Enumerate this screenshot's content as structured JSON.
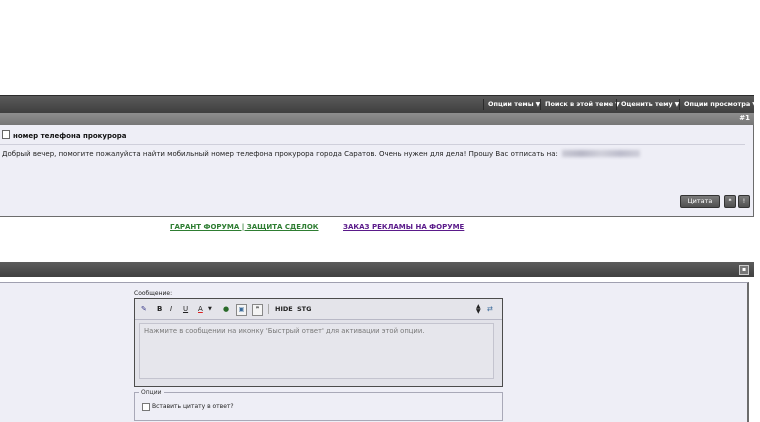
{
  "thread_tools": [
    {
      "label": "Опции темы"
    },
    {
      "label": "Поиск в этой теме"
    },
    {
      "label": "Оценить тему"
    },
    {
      "label": "Опции просмотра"
    }
  ],
  "post": {
    "number": "#1",
    "title": "номер телефона прокурора",
    "text": "Добрый вечер, помогите пожалуйста найти мобильный номер телефона прокурора города Саратов. Очень нужен для дела! Прошу Вас отписать на:",
    "quote_button": "Цитата"
  },
  "ads": {
    "guarantee": "ГАРАНТ ФОРУМА | ЗАЩИТА СДЕЛОК",
    "advertising": "ЗАКАЗ РЕКЛАМЫ НА ФОРУМЕ"
  },
  "quick_reply": {
    "message_label": "Сообщение:",
    "toolbar": {
      "bold": "B",
      "italic": "I",
      "underline": "U",
      "font_color": "A",
      "hide": "HIDE",
      "stg": "STG"
    },
    "placeholder": "Нажмите в сообщении на иконку 'Быстрый ответ' для активации этой опции.",
    "options_legend": "Опции",
    "insert_quote_label": "Вставить цитату в ответ?"
  },
  "colors": {
    "bar_dark": "#4a4a4a",
    "post_bg": "#eeeef6",
    "guarantee_link": "#2e7d32",
    "advertising_link": "#5a1a8a"
  }
}
